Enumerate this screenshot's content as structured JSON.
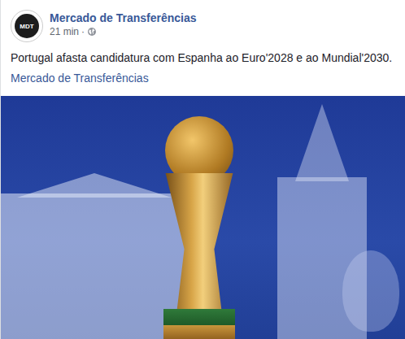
{
  "post": {
    "author": {
      "name": "Mercado de Transferências",
      "logo": "MDT"
    },
    "time": "21 min",
    "separator": "·",
    "text": "Portugal afasta candidatura com Espanha ao Euro'2028 e ao Mundial'2030.",
    "link": "Mercado de Transferências"
  }
}
